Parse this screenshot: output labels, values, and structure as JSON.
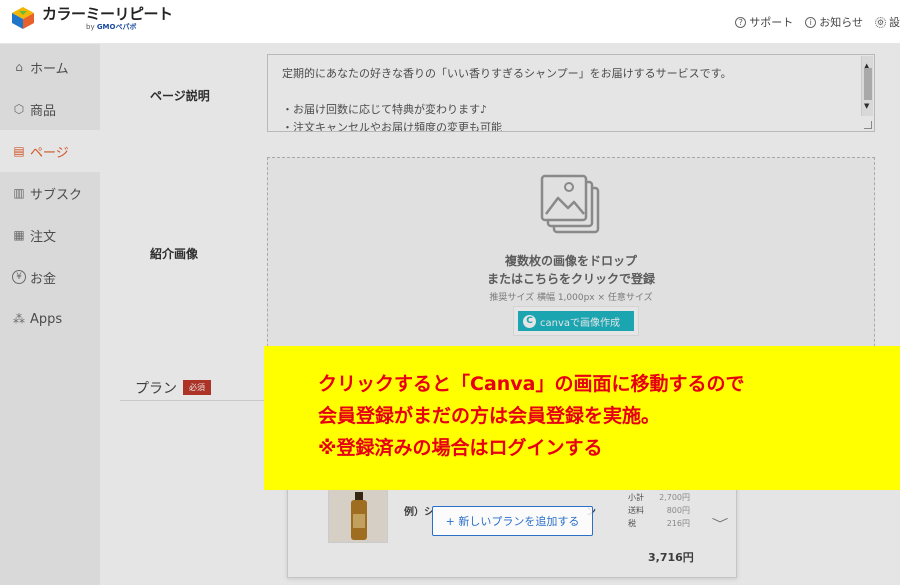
{
  "header": {
    "brand": "カラーミーリピート",
    "brand_sub_prefix": "by ",
    "brand_sub_company": "GMOペパボ",
    "nav": [
      {
        "label": "サポート",
        "icon": "help-icon"
      },
      {
        "label": "お知らせ",
        "icon": "info-icon"
      },
      {
        "label": "設",
        "icon": "gear-icon"
      }
    ]
  },
  "sidebar": {
    "items": [
      {
        "label": "ホーム",
        "icon": "home-icon"
      },
      {
        "label": "商品",
        "icon": "box-icon"
      },
      {
        "label": "ページ",
        "icon": "page-icon",
        "active": true
      },
      {
        "label": "サブスク",
        "icon": "chart-icon"
      },
      {
        "label": "注文",
        "icon": "document-icon"
      },
      {
        "label": "お金",
        "icon": "yen-icon"
      },
      {
        "label": "Apps",
        "icon": "apps-icon"
      }
    ]
  },
  "form": {
    "description_label": "ページ説明",
    "description_lines": [
      "定期的にあなたの好きな香りの「いい香りすぎるシャンプー」をお届けするサービスです。",
      "",
      "・お届け回数に応じて特典が変わります♪",
      "・注文キャンセルやお届け頻度の変更も可能"
    ],
    "image_label": "紹介画像",
    "dropzone": {
      "title_line1": "複数枚の画像をドロップ",
      "title_line2": "またはこちらをクリックで登録",
      "hint": "推奨サイズ 横幅 1,000px × 任意サイズ",
      "canva_button": "canvaで画像作成"
    },
    "plan_label": "プラン",
    "required_badge": "必須"
  },
  "plan_card": {
    "name": "例）シ",
    "name_tail": "ン",
    "subtotal_label": "小計",
    "subtotal_value": "2,700円",
    "shipping_label": "送料",
    "shipping_value": "800円",
    "tax_label": "税",
    "tax_value": "216円",
    "total": "3,716円",
    "add_button": "+ 新しいプランを追加する"
  },
  "callout": {
    "lines": [
      "クリックすると「Canva」の画面に移動するので",
      "会員登録がまだの方は会員登録を実施。",
      "※登録済みの場合はログインする"
    ],
    "colors": {
      "background": "#ffff00",
      "text": "#e60012"
    }
  },
  "colors": {
    "active_nav": "#e8602c",
    "canva": "#1db8c5",
    "link": "#2a6fc9",
    "required": "#c0392b"
  }
}
